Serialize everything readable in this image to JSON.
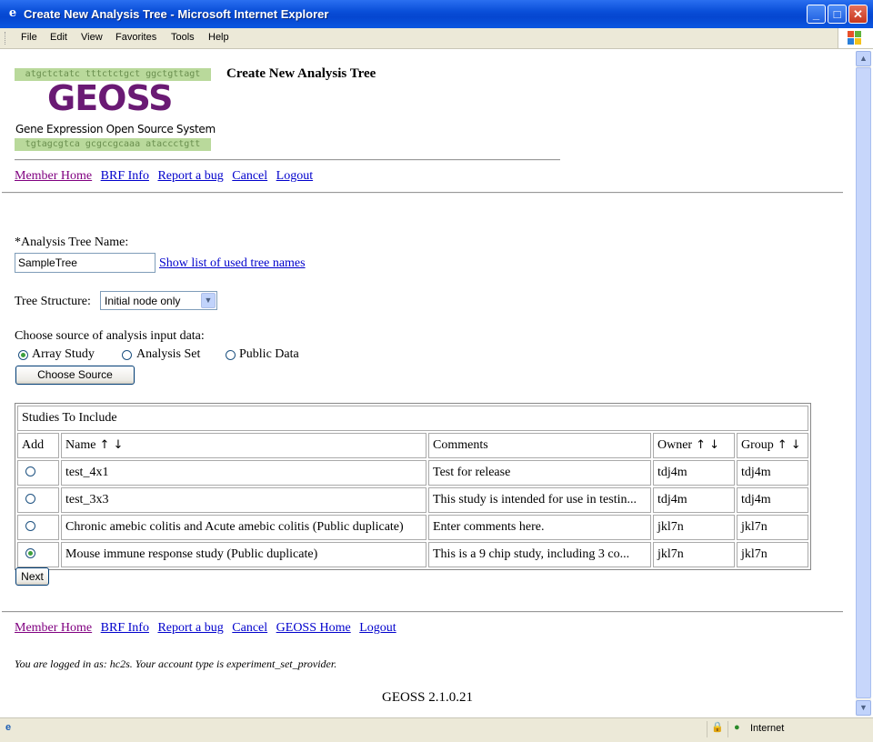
{
  "window": {
    "title": "Create New Analysis Tree - Microsoft Internet Explorer",
    "menu": [
      "File",
      "Edit",
      "View",
      "Favorites",
      "Tools",
      "Help"
    ]
  },
  "logo": {
    "dna_top": "atgctctatc tttctctgct ggctgttagt",
    "name": "GEOSS",
    "subtitle": "Gene Expression Open Source System",
    "dna_bottom": "tgtagcgtca gcgccgcaaa ataccctgtt"
  },
  "page_title": "Create New Analysis Tree",
  "top_nav": [
    "Member Home",
    "BRF Info",
    "Report a bug",
    "Cancel",
    "Logout"
  ],
  "form": {
    "tree_name_label": "*Analysis Tree Name:",
    "tree_name_value": "SampleTree",
    "show_list_link": "Show list of used tree names",
    "tree_structure_label": "Tree Structure:",
    "tree_structure_value": "Initial node only",
    "source_label": "Choose source of analysis input data:",
    "sources": [
      {
        "label": "Array Study",
        "selected": true
      },
      {
        "label": "Analysis Set",
        "selected": false
      },
      {
        "label": "Public Data",
        "selected": false
      }
    ],
    "choose_source_button": "Choose Source"
  },
  "studies": {
    "caption": "Studies To Include",
    "headers": {
      "add": "Add",
      "name": "Name",
      "comments": "Comments",
      "owner": "Owner",
      "group": "Group"
    },
    "sort_arrows": "↑ ↓",
    "rows": [
      {
        "selected": false,
        "name": "test_4x1",
        "comments": "Test for release",
        "owner": "tdj4m",
        "group": "tdj4m"
      },
      {
        "selected": false,
        "name": "test_3x3",
        "comments": "This study is intended for use in testin...",
        "owner": "tdj4m",
        "group": "tdj4m"
      },
      {
        "selected": false,
        "name": "Chronic amebic colitis and Acute amebic colitis (Public duplicate)",
        "comments": "Enter comments here.",
        "owner": "jkl7n",
        "group": "jkl7n"
      },
      {
        "selected": true,
        "name": "Mouse immune response study (Public duplicate)",
        "comments": "This is a 9 chip study, including 3 co...",
        "owner": "jkl7n",
        "group": "jkl7n"
      }
    ]
  },
  "next_button": "Next",
  "bottom_nav": [
    "Member Home",
    "BRF Info",
    "Report a bug",
    "Cancel",
    "GEOSS Home",
    "Logout"
  ],
  "login_info": "You are logged in as: hc2s. Your account type is experiment_set_provider.",
  "version": "GEOSS 2.1.0.21",
  "status": {
    "zone": "Internet"
  }
}
